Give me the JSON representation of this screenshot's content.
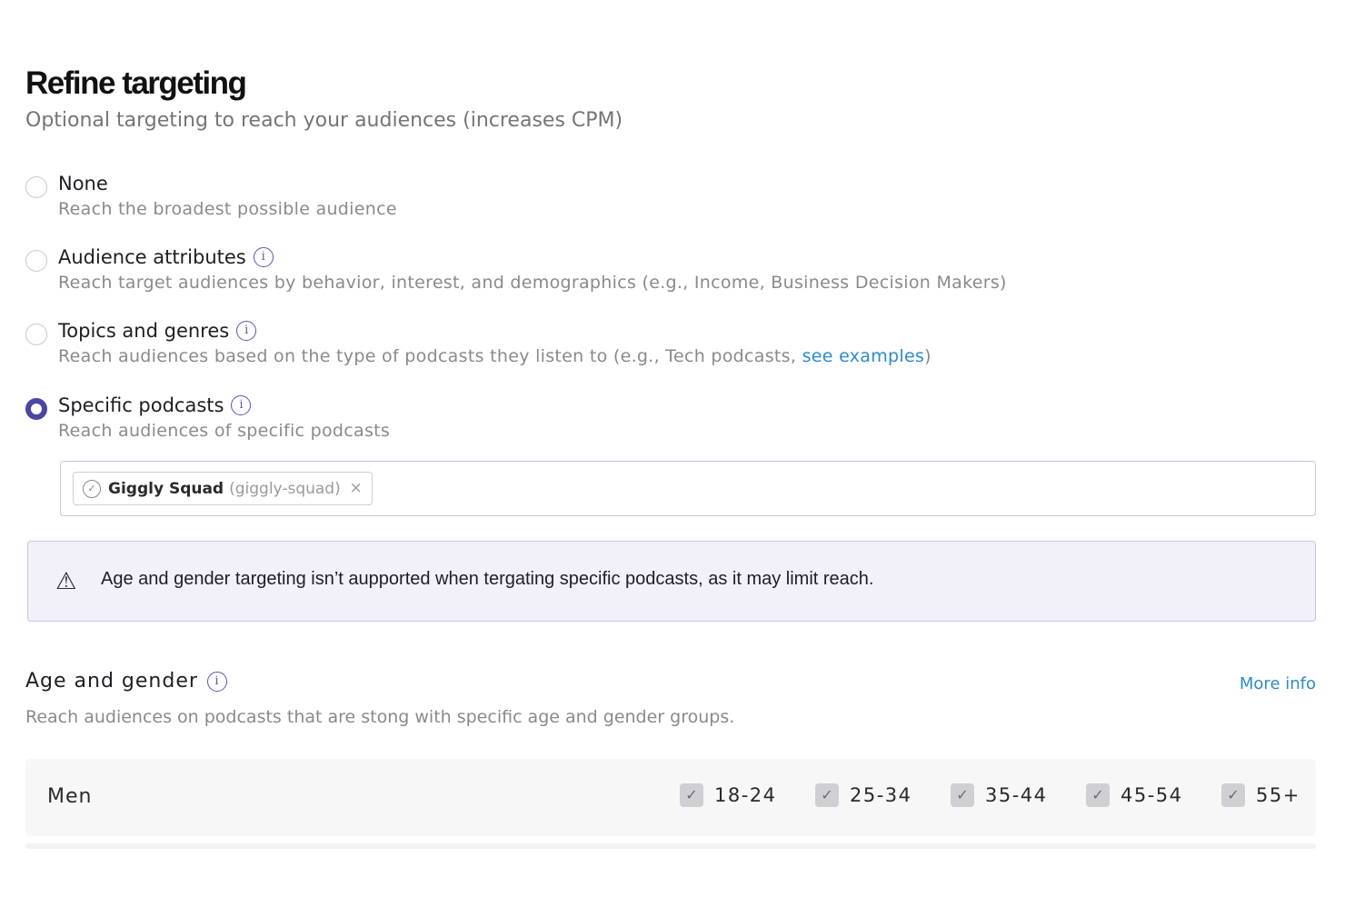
{
  "header": {
    "title": "Refine targeting",
    "subtitle": "Optional targeting to reach your audiences (increases CPM)"
  },
  "options": [
    {
      "label": "None",
      "description": "Reach the broadest possible audience",
      "selected": false,
      "has_info": false
    },
    {
      "label": "Audience attributes",
      "description": "Reach target audiences by behavior, interest, and demographics (e.g., Income, Business Decision Makers)",
      "selected": false,
      "has_info": true
    },
    {
      "label": "Topics and genres",
      "description_prefix": "Reach audiences based on the type of podcasts they listen to (e.g., Tech podcasts, ",
      "description_link": "see examples",
      "description_suffix": ")",
      "selected": false,
      "has_info": true
    },
    {
      "label": "Specific podcasts",
      "description": "Reach audiences of specific podcasts",
      "selected": true,
      "has_info": true
    }
  ],
  "podcast_input": {
    "chips": [
      {
        "name": "Giggly Squad",
        "slug": "(giggly-squad)",
        "remove": "×"
      }
    ]
  },
  "alert": {
    "icon": "warning-triangle-icon",
    "text": "Age and gender targeting isn’t aupported when tergating specific podcasts, as it may limit reach."
  },
  "age_gender": {
    "title": "Age and gender",
    "more_info": "More info",
    "description": "Reach audiences on podcasts that are stong with specific age and gender groups.",
    "rows": [
      {
        "label": "Men",
        "ages": [
          "18-24",
          "25-34",
          "35-44",
          "45-54",
          "55+"
        ]
      }
    ]
  },
  "colors": {
    "accent": "#4b45a3",
    "link": "#2e8bc9",
    "alert_bg": "#f2f1fa"
  }
}
